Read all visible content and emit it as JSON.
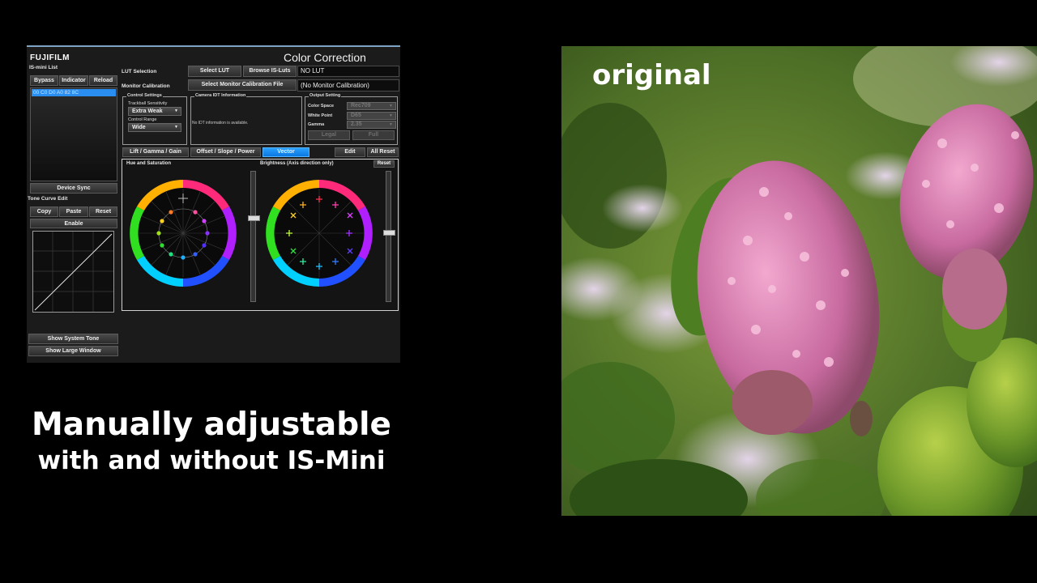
{
  "app": {
    "brand": "FUJIFILM",
    "title": "Color Correction",
    "is_mini_list_label": "IS-mini List",
    "top_buttons": [
      "Bypass",
      "Indicator",
      "Reload"
    ],
    "list_items": [
      "00 C0 D0 A0 82 8C"
    ],
    "device_sync": "Device Sync",
    "tone_curve_label": "Tone Curve Edit",
    "tone_buttons": [
      "Copy",
      "Paste",
      "Reset"
    ],
    "enable": "Enable",
    "show_system_tone": "Show System Tone",
    "show_large_window": "Show Large Window",
    "lut_selection_label": "LUT Selection",
    "select_lut": "Select LUT",
    "browse_luts": "Browse IS-Luts",
    "lut_value": "NO LUT",
    "monitor_calibration_label": "Monitor Calibration",
    "select_monitor_file": "Select Monitor Calibration File",
    "monitor_value": "(No Monitor Calibration)",
    "control_settings": {
      "title": "Control Settings",
      "trackball_label": "Trackball Sensitivity",
      "trackball_value": "Extra Weak",
      "range_label": "Control Range",
      "range_value": "Wide"
    },
    "idt": {
      "title": "Camera IDT Information",
      "message": "No IDT information is available."
    },
    "output": {
      "title": "Output Setting",
      "color_space_label": "Color Space",
      "color_space_value": "Rec709",
      "white_point_label": "White Point",
      "white_point_value": "D65",
      "gamma_label": "Gamma",
      "gamma_value": "2.35",
      "legal": "Legal",
      "full": "Full"
    },
    "tabs": [
      "Lift / Gamma / Gain",
      "Offset / Slope / Power",
      "Vector"
    ],
    "active_tab": "Vector",
    "edit": "Edit",
    "all_reset": "All Reset",
    "hue_saturation_label": "Hue and Saturation",
    "brightness_label": "Brightness (Axis direction only)",
    "reset": "Reset"
  },
  "caption": {
    "line1": "Manually adjustable",
    "line2": "with and without IS-Mini"
  },
  "photo": {
    "label": "original"
  },
  "colors": {
    "accent": "#1e8cf0",
    "panel_bg": "#1b1b1b"
  }
}
